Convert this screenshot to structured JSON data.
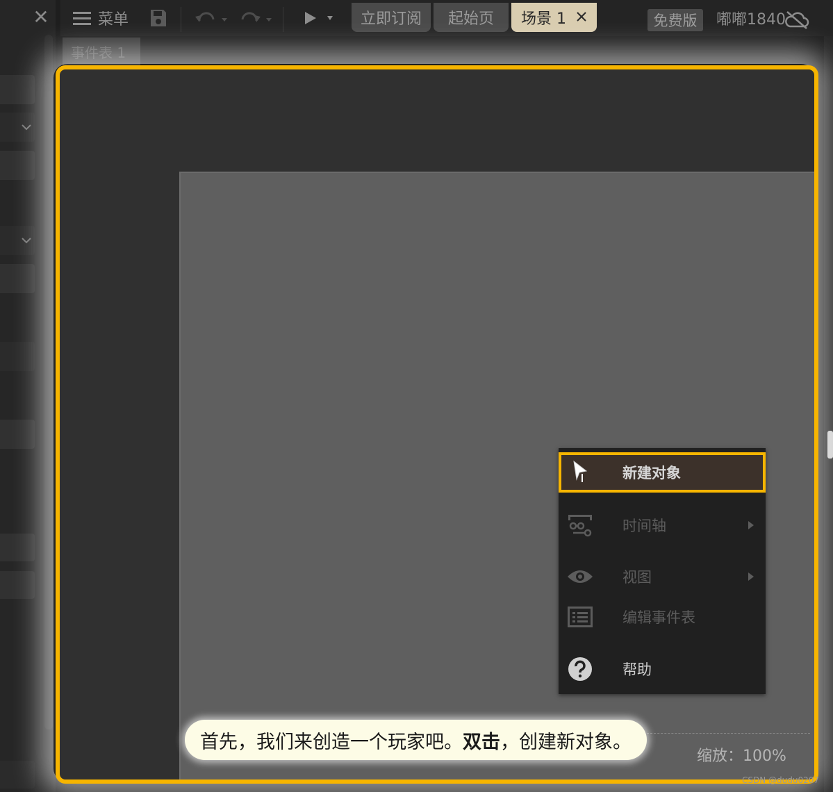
{
  "toolbar": {
    "menu_label": "菜单",
    "tabs": {
      "subscribe": "立即订阅",
      "start_page": "起始页",
      "scene": "场景 1"
    },
    "edition_badge": "免费版",
    "username": "嘟嘟1840"
  },
  "sheet_tab": "事件表 1",
  "context_menu": {
    "new_object": "新建对象",
    "timeline": "时间轴",
    "view": "视图",
    "edit_event_sheet": "编辑事件表",
    "help": "帮助"
  },
  "tooltip": {
    "prefix": "首先，我们来创造一个玩家吧。",
    "bold": "双击",
    "suffix": "，创建新对象。"
  },
  "status": {
    "zoom": "缩放：100%"
  },
  "watermark": "CSDN @dudu0207",
  "colors": {
    "highlight": "#f7b500",
    "active_tab": "#d9cdb0",
    "tooltip_bg": "#fdfce6"
  }
}
